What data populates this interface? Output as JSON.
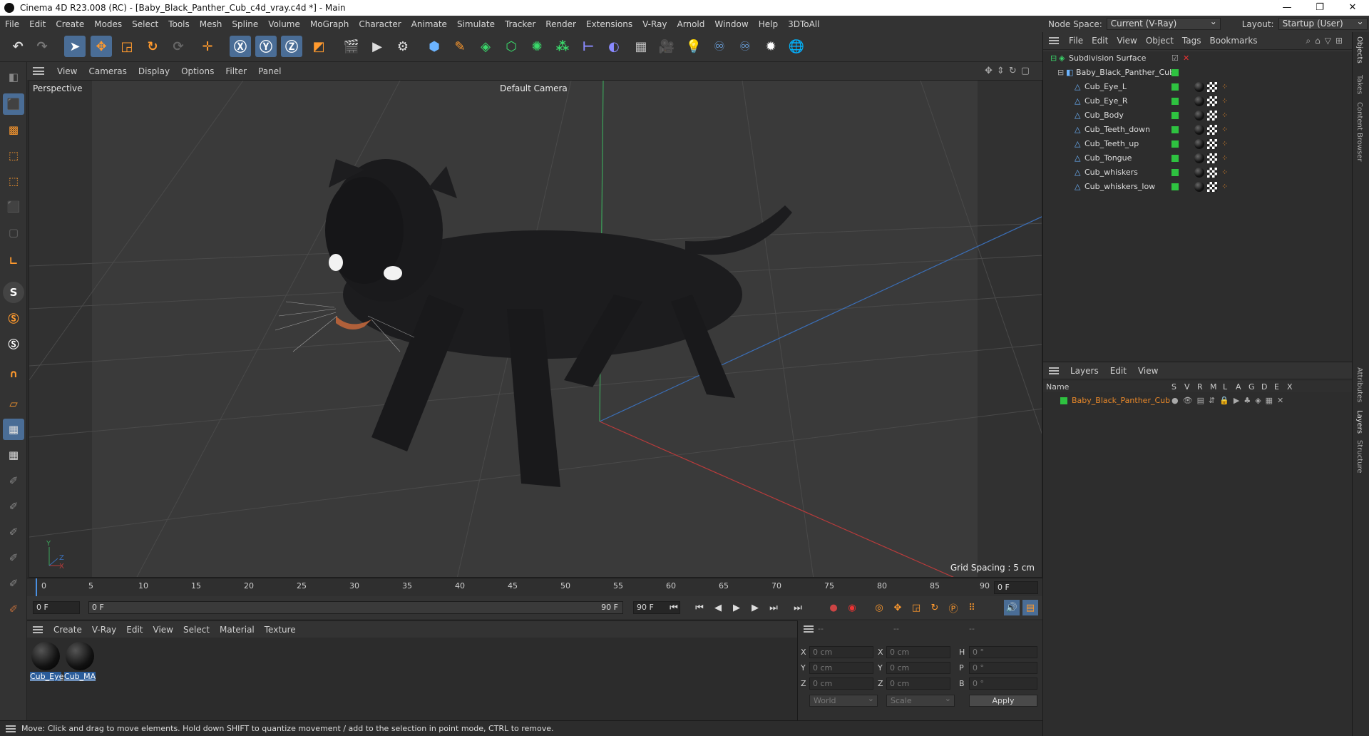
{
  "window": {
    "title": "Cinema 4D R23.008 (RC) - [Baby_Black_Panther_Cub_c4d_vray.c4d *] - Main",
    "minimize": "—",
    "maximize": "❐",
    "close": "✕"
  },
  "menubar": [
    "File",
    "Edit",
    "Create",
    "Modes",
    "Select",
    "Tools",
    "Mesh",
    "Spline",
    "Volume",
    "MoGraph",
    "Character",
    "Animate",
    "Simulate",
    "Tracker",
    "Render",
    "Extensions",
    "V-Ray",
    "Arnold",
    "Window",
    "Help",
    "3DToAll"
  ],
  "nodespace": {
    "label": "Node Space:",
    "value": "Current (V-Ray)",
    "layout_label": "Layout:",
    "layout_value": "Startup (User)"
  },
  "viewport": {
    "menu": [
      "View",
      "Cameras",
      "Display",
      "Options",
      "Filter",
      "Panel"
    ],
    "label": "Perspective",
    "camera": "Default Camera",
    "grid_spacing": "Grid Spacing : 5 cm",
    "axis_y": "Y",
    "axis_z": "Z",
    "axis_x": "X"
  },
  "timeline": {
    "ticks": [
      "0",
      "5",
      "10",
      "15",
      "20",
      "25",
      "30",
      "35",
      "40",
      "45",
      "50",
      "55",
      "60",
      "65",
      "70",
      "75",
      "80",
      "85",
      "90"
    ],
    "current_frame": "0 F"
  },
  "playbar": {
    "start": "0 F",
    "range_start": "0 F",
    "range_end": "90 F",
    "end": "90 F"
  },
  "material_menu": [
    "Create",
    "V-Ray",
    "Edit",
    "View",
    "Select",
    "Material",
    "Texture"
  ],
  "materials": [
    "Cub_Eye",
    "Cub_MA"
  ],
  "coords": {
    "headers": [
      "--",
      "--",
      "--"
    ],
    "rows": [
      {
        "a": "X",
        "av": "0 cm",
        "b": "X",
        "bv": "0 cm",
        "c": "H",
        "cv": "0 °"
      },
      {
        "a": "Y",
        "av": "0 cm",
        "b": "Y",
        "bv": "0 cm",
        "c": "P",
        "cv": "0 °"
      },
      {
        "a": "Z",
        "av": "0 cm",
        "b": "Z",
        "bv": "0 cm",
        "c": "B",
        "cv": "0 °"
      }
    ],
    "world": "World",
    "scale": "Scale",
    "apply": "Apply"
  },
  "status": "Move: Click and drag to move elements. Hold down SHIFT to quantize movement / add to the selection in point mode, CTRL to remove.",
  "object_menu": [
    "File",
    "Edit",
    "View",
    "Object",
    "Tags",
    "Bookmarks"
  ],
  "objects": [
    "Subdivision Surface",
    "Baby_Black_Panther_Cub",
    "Cub_Eye_L",
    "Cub_Eye_R",
    "Cub_Body",
    "Cub_Teeth_down",
    "Cub_Teeth_up",
    "Cub_Tongue",
    "Cub_whiskers",
    "Cub_whiskers_low"
  ],
  "layers_menu": [
    "Layers",
    "Edit",
    "View"
  ],
  "layers_header": {
    "name": "Name",
    "cols": [
      "S",
      "V",
      "R",
      "M",
      "L",
      "A",
      "G",
      "D",
      "E",
      "X"
    ]
  },
  "layers": [
    "Baby_Black_Panther_Cub"
  ],
  "side_tabs": [
    "Objects",
    "Takes",
    "Content Browser",
    "Attributes",
    "Layers",
    "Structure"
  ],
  "colors": {
    "accent": "#2ec240",
    "selection": "#2a5c9a",
    "orange": "#e8882a"
  }
}
